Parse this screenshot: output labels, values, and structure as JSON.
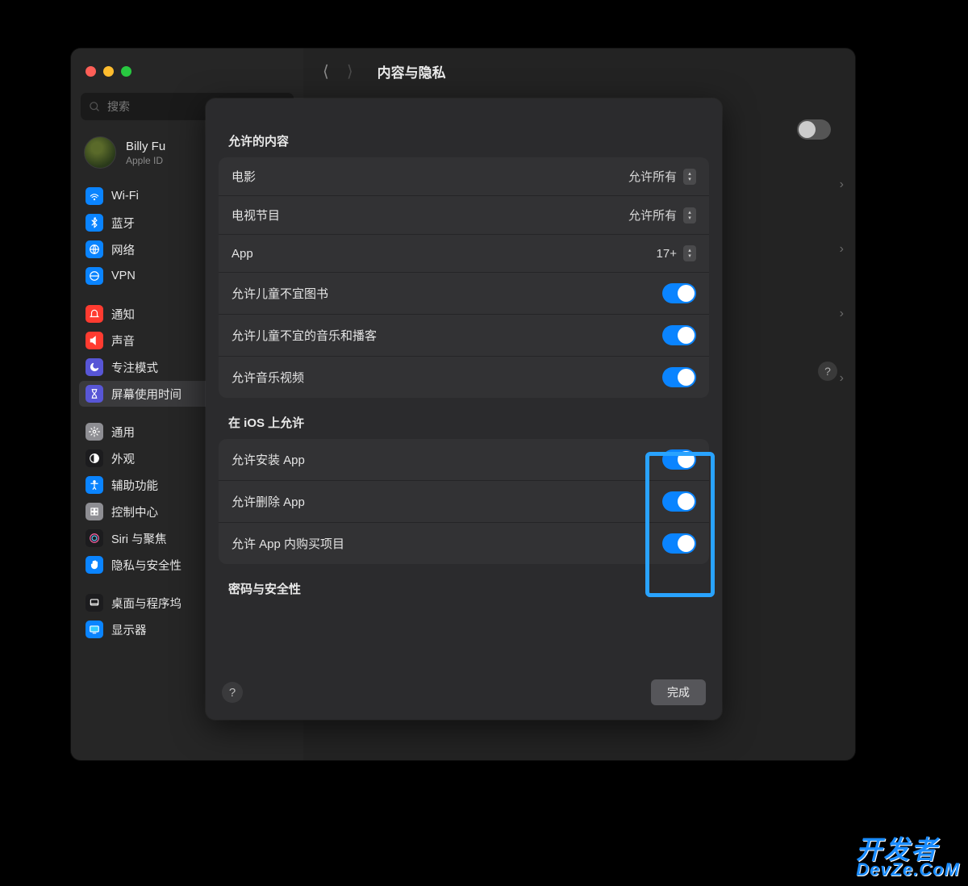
{
  "header": {
    "title": "内容与隐私"
  },
  "search": {
    "placeholder": "搜索"
  },
  "account": {
    "name": "Billy Fu",
    "sub": "Apple ID"
  },
  "sidebar": {
    "items": [
      {
        "label": "Wi-Fi",
        "iconBg": "#0a84ff",
        "glyph": "wifi"
      },
      {
        "label": "蓝牙",
        "iconBg": "#0a84ff",
        "glyph": "bt"
      },
      {
        "label": "网络",
        "iconBg": "#0a84ff",
        "glyph": "globe"
      },
      {
        "label": "VPN",
        "iconBg": "#0a84ff",
        "glyph": "vpn"
      },
      {
        "gap": true
      },
      {
        "label": "通知",
        "iconBg": "#ff3b30",
        "glyph": "bell"
      },
      {
        "label": "声音",
        "iconBg": "#ff3b30",
        "glyph": "sound"
      },
      {
        "label": "专注模式",
        "iconBg": "#5856d6",
        "glyph": "moon"
      },
      {
        "label": "屏幕使用时间",
        "iconBg": "#5856d6",
        "glyph": "hourglass",
        "selected": true
      },
      {
        "gap": true
      },
      {
        "label": "通用",
        "iconBg": "#8e8e93",
        "glyph": "gear"
      },
      {
        "label": "外观",
        "iconBg": "#1c1c1e",
        "glyph": "appearance"
      },
      {
        "label": "辅助功能",
        "iconBg": "#0a84ff",
        "glyph": "access"
      },
      {
        "label": "控制中心",
        "iconBg": "#8e8e93",
        "glyph": "control"
      },
      {
        "label": "Siri 与聚焦",
        "iconBg": "#1c1c1e",
        "glyph": "siri"
      },
      {
        "label": "隐私与安全性",
        "iconBg": "#0a84ff",
        "glyph": "hand"
      },
      {
        "gap": true
      },
      {
        "label": "桌面与程序坞",
        "iconBg": "#1c1c1e",
        "glyph": "dock"
      },
      {
        "label": "显示器",
        "iconBg": "#0a84ff",
        "glyph": "display"
      }
    ]
  },
  "sheet": {
    "sections": [
      {
        "title": "允许的内容",
        "rows": [
          {
            "label": "电影",
            "type": "select",
            "value": "允许所有"
          },
          {
            "label": "电视节目",
            "type": "select",
            "value": "允许所有"
          },
          {
            "label": "App",
            "type": "select",
            "value": "17+"
          },
          {
            "label": "允许儿童不宜图书",
            "type": "toggle",
            "on": true
          },
          {
            "label": "允许儿童不宜的音乐和播客",
            "type": "toggle",
            "on": true
          },
          {
            "label": "允许音乐视频",
            "type": "toggle",
            "on": true
          }
        ]
      },
      {
        "title": "在 iOS 上允许",
        "rows": [
          {
            "label": "允许安装 App",
            "type": "toggle",
            "on": true
          },
          {
            "label": "允许删除 App",
            "type": "toggle",
            "on": true
          },
          {
            "label": "允许 App 内购买项目",
            "type": "toggle",
            "on": true
          }
        ]
      },
      {
        "title": "密码与安全性",
        "rows": []
      }
    ],
    "done": "完成"
  },
  "watermark": {
    "l1": "开发者",
    "l2": "DevZe.CoM"
  }
}
